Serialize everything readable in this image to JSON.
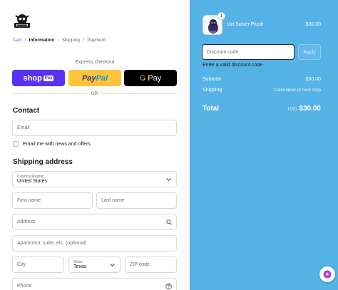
{
  "breadcrumb": {
    "cart": "Cart",
    "information": "Information",
    "shipping": "Shipping",
    "payment": "Payment",
    "separator": "›"
  },
  "express": {
    "label": "Express checkout",
    "shop_label": "shop",
    "shop_pay_tag": "Pay",
    "paypal_part1": "Pay",
    "paypal_part2": "Pal",
    "gpay_g": "G",
    "gpay_label": "Pay",
    "or_label": "OR"
  },
  "contact": {
    "heading": "Contact",
    "email_placeholder": "Email",
    "newsletter_label": "Email me with news and offers"
  },
  "shipping": {
    "heading": "Shipping address",
    "country_label": "Country/Region",
    "country_value": "United States",
    "first_name_placeholder": "First name",
    "last_name_placeholder": "Last name",
    "address_placeholder": "Address",
    "apartment_placeholder": "Apartment, suite, etc. (optional)",
    "city_placeholder": "City",
    "state_label": "State",
    "state_value": "Texas",
    "zip_placeholder": "ZIP code",
    "phone_placeholder": "Phone"
  },
  "summary": {
    "product_name": "Uzi Solver Plush",
    "product_price": "$30.00",
    "quantity_badge": "1",
    "discount_placeholder": "Discount code",
    "apply_label": "Apply",
    "discount_error": "Enter a valid discount code",
    "subtotal_label": "Subtotal",
    "subtotal_value": "$30.00",
    "shipping_label": "Shipping",
    "shipping_value": "Calculated at next step",
    "total_label": "Total",
    "total_currency": "USD",
    "total_value": "$30.00"
  },
  "colors": {
    "summary_bg": "#55b2e6",
    "shop_pay": "#5a31f4",
    "paypal": "#ffc439",
    "gpay": "#000000",
    "link": "#2a6fdb"
  }
}
